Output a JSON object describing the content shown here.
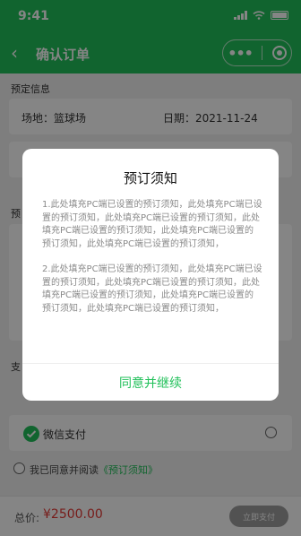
{
  "status_bar": {
    "time": "9:41"
  },
  "nav": {
    "back_icon": "‹",
    "title": "确认订单",
    "more_icon": "•••"
  },
  "booking_info": {
    "section_label": "预定信息",
    "venue": "场地：篮球场",
    "date": "日期：2021-11-24"
  },
  "section_fragments": {
    "reserve": "预",
    "pay": "支"
  },
  "payment": {
    "method_label": "微信支付"
  },
  "agreement": {
    "prefix": "我已同意并阅读",
    "link": "《预订须知》"
  },
  "bottom_bar": {
    "total_label": "总价:",
    "total_price": "¥2500.00",
    "pay_button": "立即支付"
  },
  "modal": {
    "title": "预订须知",
    "paragraphs": [
      "1.此处填充PC端已设置的预订须知，此处填充PC端已设置的预订须知，此处填充PC端已设置的预订须知，此处填充PC端已设置的预订须知，此处填充PC端已设置的预订须知，此处填充PC端已设置的预订须知，",
      "2.此处填充PC端已设置的预订须知，此处填充PC端已设置的预订须知，此处填充PC端已设置的预订须知，此处填充PC端已设置的预订须知，此处填充PC端已设置的预订须知，此处填充PC端已设置的预订须知，"
    ],
    "confirm_button": "同意并继续"
  },
  "colors": {
    "brand": "#21c05a",
    "price": "#e53935"
  }
}
